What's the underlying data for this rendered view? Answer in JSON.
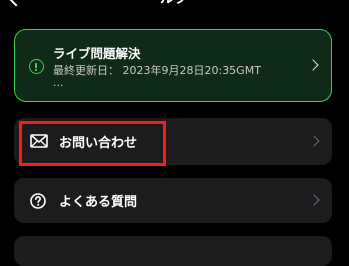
{
  "header": {
    "back_icon": "chevron-left-icon",
    "title_fragment": "ルプ"
  },
  "status": {
    "title": "ライブ問題解決",
    "updated": "最終更新日： 2023年9月28日20:35GMT",
    "ellipsis": "...",
    "icon": "info-icon",
    "accent_color": "#39d353"
  },
  "menu": {
    "contact_label": "お問い合わせ",
    "contact_icon": "envelope-icon",
    "faq_label": "よくある質問",
    "faq_icon": "question-circle-icon"
  },
  "annotation": {
    "highlight_color": "#ff1a1a"
  }
}
